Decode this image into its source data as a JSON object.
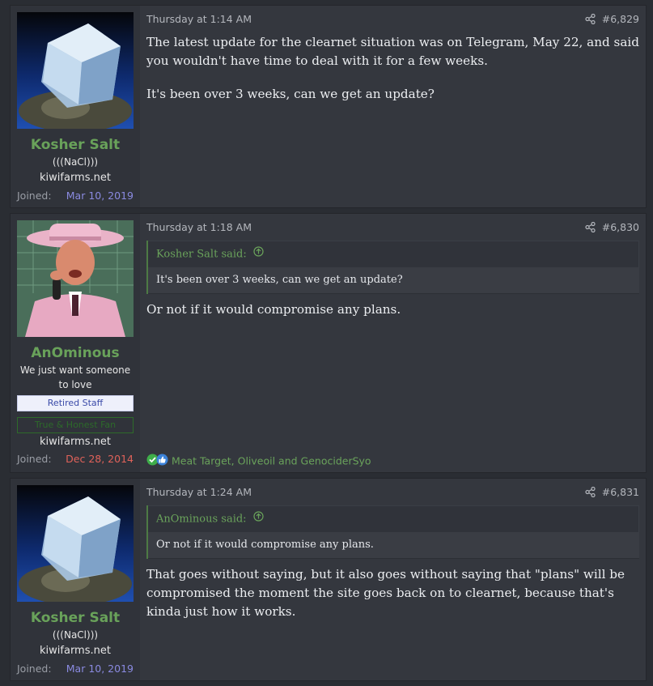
{
  "posts": [
    {
      "username": "Kosher Salt",
      "user_title": "(((NaCl)))",
      "site": "kiwifarms.net",
      "joined_label": "Joined:",
      "joined_date": "Mar 10, 2019",
      "joined_color": "#8a8ae0",
      "date": "Thursday at 1:14 AM",
      "post_number": "#6,829",
      "paragraphs": [
        "The latest update for the clearnet situation was on Telegram, May 22, and said you wouldn't have time to deal with it for a few weeks.",
        "It's been over 3 weeks, can we get an update?"
      ]
    },
    {
      "username": "AnOminous",
      "user_title": "We just want someone to love",
      "banners": [
        "Retired Staff",
        "True & Honest Fan"
      ],
      "site": "kiwifarms.net",
      "joined_label": "Joined:",
      "joined_date": "Dec 28, 2014",
      "joined_color": "#e0625a",
      "date": "Thursday at 1:18 AM",
      "post_number": "#6,830",
      "quote_author": "Kosher Salt said:",
      "quote_text": "It's been over 3 weeks, can we get an update?",
      "paragraphs": [
        "Or not if it would compromise any plans."
      ],
      "reactions": "Meat Target, Oliveoil and GenociderSyo"
    },
    {
      "username": "Kosher Salt",
      "user_title": "(((NaCl)))",
      "site": "kiwifarms.net",
      "joined_label": "Joined:",
      "joined_date": "Mar 10, 2019",
      "joined_color": "#8a8ae0",
      "date": "Thursday at 1:24 AM",
      "post_number": "#6,831",
      "quote_author": "AnOminous said:",
      "quote_text": "Or not if it would compromise any plans.",
      "paragraphs": [
        "That goes without saying, but it also goes without saying that \"plans\" will be compromised the moment the site goes back on to clearnet, because that's kinda just how it works."
      ]
    }
  ]
}
